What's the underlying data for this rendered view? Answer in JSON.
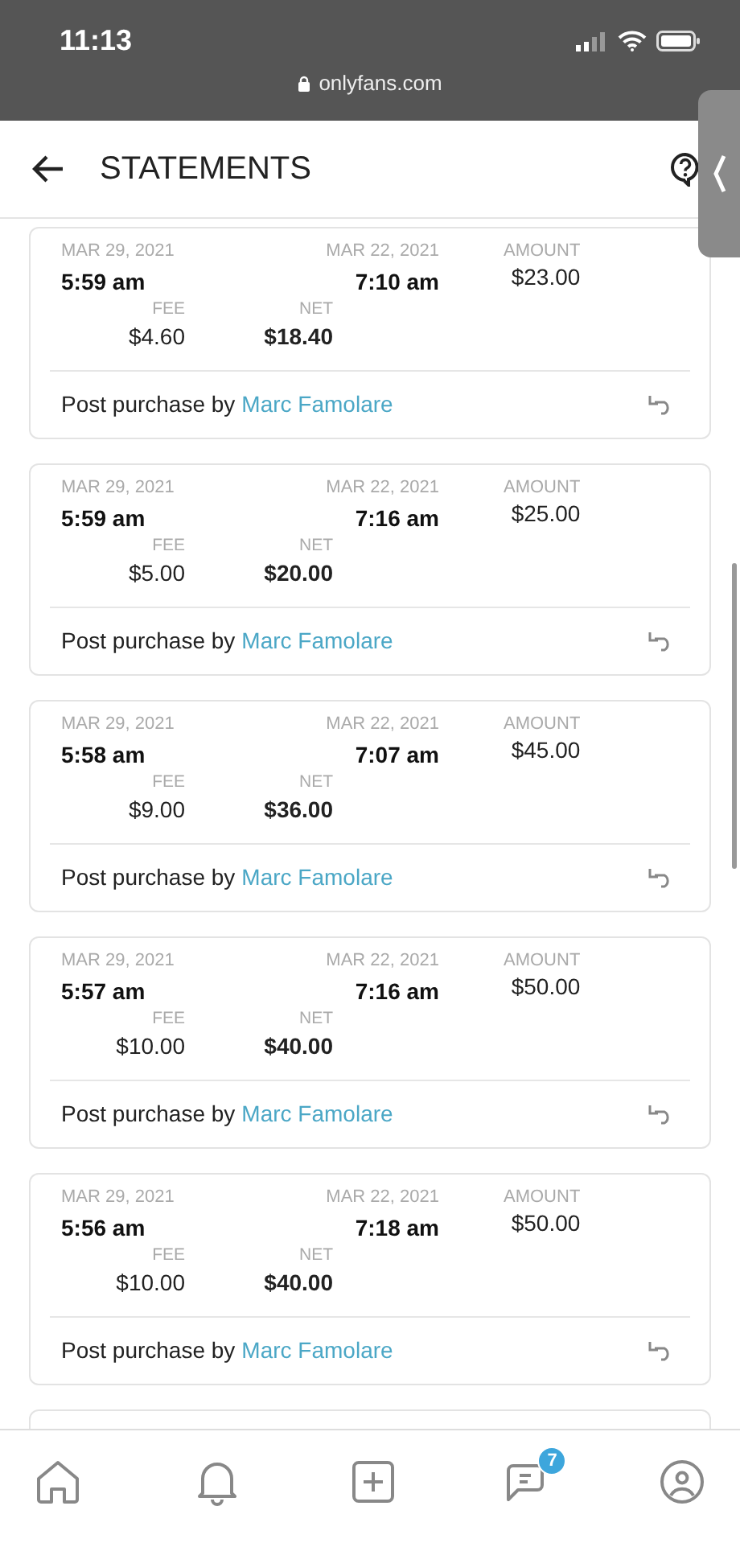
{
  "status_bar": {
    "time": "11:13",
    "url": "onlyfans.com"
  },
  "header": {
    "title": "STATEMENTS"
  },
  "statements": [
    {
      "date_1": "MAR 29, 2021",
      "time_1": "5:59 am",
      "date_2": "MAR 22, 2021",
      "time_2": "7:10 am",
      "amount_label": "AMOUNT",
      "amount": "$23.00",
      "fee_label": "FEE",
      "fee": "$4.60",
      "net_label": "NET",
      "net": "$18.40",
      "description": "Post purchase by",
      "user": "Marc Famolare"
    },
    {
      "date_1": "MAR 29, 2021",
      "time_1": "5:59 am",
      "date_2": "MAR 22, 2021",
      "time_2": "7:16 am",
      "amount_label": "AMOUNT",
      "amount": "$25.00",
      "fee_label": "FEE",
      "fee": "$5.00",
      "net_label": "NET",
      "net": "$20.00",
      "description": "Post purchase by",
      "user": "Marc Famolare"
    },
    {
      "date_1": "MAR 29, 2021",
      "time_1": "5:58 am",
      "date_2": "MAR 22, 2021",
      "time_2": "7:07 am",
      "amount_label": "AMOUNT",
      "amount": "$45.00",
      "fee_label": "FEE",
      "fee": "$9.00",
      "net_label": "NET",
      "net": "$36.00",
      "description": "Post purchase by",
      "user": "Marc Famolare"
    },
    {
      "date_1": "MAR 29, 2021",
      "time_1": "5:57 am",
      "date_2": "MAR 22, 2021",
      "time_2": "7:16 am",
      "amount_label": "AMOUNT",
      "amount": "$50.00",
      "fee_label": "FEE",
      "fee": "$10.00",
      "net_label": "NET",
      "net": "$40.00",
      "description": "Post purchase by",
      "user": "Marc Famolare"
    },
    {
      "date_1": "MAR 29, 2021",
      "time_1": "5:56 am",
      "date_2": "MAR 22, 2021",
      "time_2": "7:18 am",
      "amount_label": "AMOUNT",
      "amount": "$50.00",
      "fee_label": "FEE",
      "fee": "$10.00",
      "net_label": "NET",
      "net": "$40.00",
      "description": "Post purchase by",
      "user": "Marc Famolare"
    }
  ],
  "bottom_nav": {
    "messages_badge": "7"
  }
}
